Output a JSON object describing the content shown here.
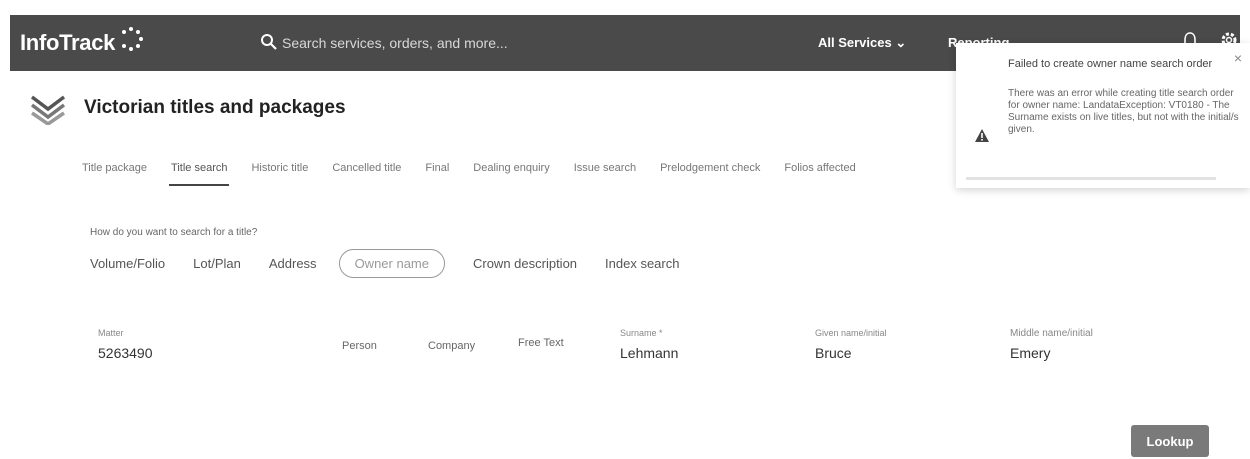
{
  "header": {
    "logo_text": "InfoTrack",
    "search_placeholder": "Search services, orders, and more...",
    "all_services_label": "All Services ⌄",
    "reporting_label": "Reporting ⌄"
  },
  "toast": {
    "title": "Failed to create owner name search order",
    "message": "There was an error while creating title search order for owner name: LandataException: VT0180 - The Surname exists on live titles, but not with the initial/s given.",
    "close_label": "×"
  },
  "page": {
    "title": "Victorian titles and packages"
  },
  "tabs": [
    {
      "label": "Title package"
    },
    {
      "label": "Title search"
    },
    {
      "label": "Historic title"
    },
    {
      "label": "Cancelled title"
    },
    {
      "label": "Final"
    },
    {
      "label": "Dealing enquiry"
    },
    {
      "label": "Issue search"
    },
    {
      "label": "Prelodgement check"
    },
    {
      "label": "Folios affected"
    }
  ],
  "search": {
    "question": "How do you want to search for a title?",
    "types": [
      {
        "label": "Volume/Folio"
      },
      {
        "label": "Lot/Plan"
      },
      {
        "label": "Address"
      },
      {
        "label": "Owner name"
      },
      {
        "label": "Crown description"
      },
      {
        "label": "Index search"
      }
    ]
  },
  "form": {
    "matter_label": "Matter",
    "matter_value": "5263490",
    "person_label": "Person",
    "company_label": "Company",
    "freetext_label": "Free Text",
    "surname_label": "Surname *",
    "surname_value": "Lehmann",
    "given_label": "Given name/initial",
    "given_value": "Bruce",
    "middle_label": "Middle name/initial",
    "middle_value": "Emery",
    "lookup_label": "Lookup"
  },
  "colors": {
    "topbar": "#4a4a4a",
    "button": "#7a7a7a"
  }
}
